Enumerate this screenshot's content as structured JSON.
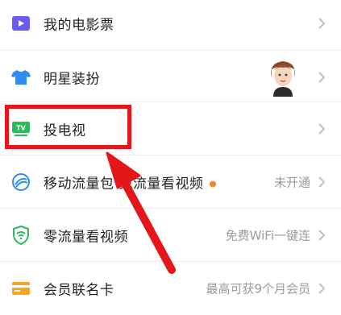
{
  "menu": {
    "items": [
      {
        "label": "我的电影票",
        "icon": "ticket-icon",
        "status": ""
      },
      {
        "label": "明星装扮",
        "icon": "tshirt-icon",
        "status": ""
      },
      {
        "label": "投电视",
        "icon": "tv-icon",
        "status": ""
      },
      {
        "label": "移动流量包 免流量看视频",
        "icon": "mobile-data-icon",
        "status": "未开通"
      },
      {
        "label": "零流量看视频",
        "icon": "shield-icon",
        "status": "免费WiFi一键连"
      },
      {
        "label": "会员联名卡",
        "icon": "card-icon",
        "status": "最高可获9个月会员"
      }
    ]
  },
  "colors": {
    "ticket": "#6b5cf0",
    "tshirt": "#2e8df0",
    "tv": "#2dbb5a",
    "mobile": "#2e8df0",
    "shield": "#2dbb5a",
    "card": "#f5a623",
    "highlight": "#e4161a",
    "dot": "#f08a24"
  }
}
